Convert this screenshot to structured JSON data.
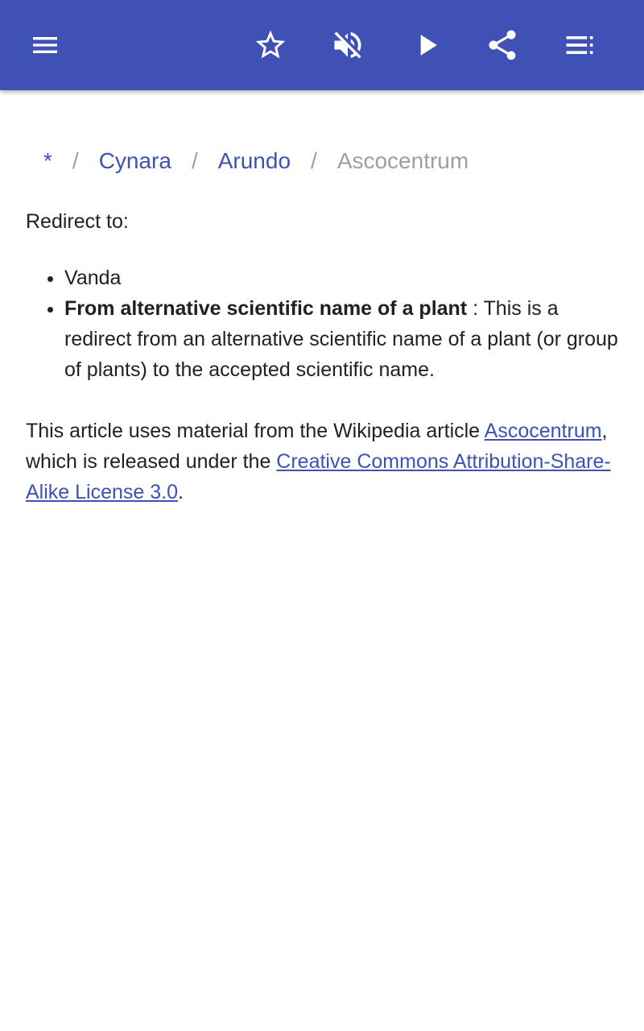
{
  "toolbar": {
    "icons": [
      "menu-icon",
      "star-icon",
      "volume-off-icon",
      "play-icon",
      "share-icon",
      "playlist-icon"
    ],
    "background_color": "#3f51b5",
    "icon_color": "#ffffff"
  },
  "breadcrumb": {
    "items": [
      "*",
      "Cynara",
      "Arundo"
    ],
    "separator": "/",
    "current": "Ascocentrum"
  },
  "article": {
    "redirect_label": "Redirect to:",
    "list": {
      "item1": "Vanda",
      "item2_bold": "From alternative scientific name of a plant",
      "item2_text": " : This is a redirect from an alternative scientific name of a plant (or group of plants) to the accepted scientific name."
    },
    "attribution": {
      "prefix": "This article uses material from the Wikipedia article ",
      "article_link": "Ascocentrum",
      "middle": ", which is released under the ",
      "license_link": "Creative Commons Attribution-Share-Alike License 3.0",
      "suffix": "."
    }
  },
  "colors": {
    "link": "#3f51b5",
    "muted": "#9e9e9e",
    "text": "#212121"
  }
}
